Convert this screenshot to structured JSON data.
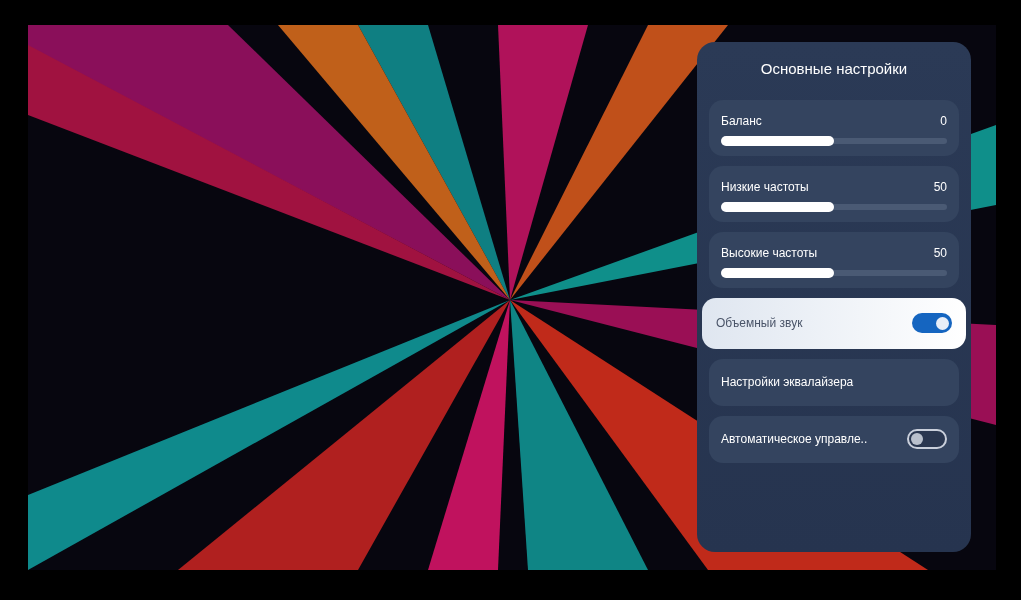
{
  "panel": {
    "title": "Основные настройки",
    "items": [
      {
        "kind": "slider",
        "label": "Баланс",
        "reading": "0",
        "level": 0.5,
        "selected": false
      },
      {
        "kind": "slider",
        "label": "Низкие частоты",
        "reading": "50",
        "level": 0.5,
        "selected": false
      },
      {
        "kind": "slider",
        "label": "Высокие частоты",
        "reading": "50",
        "level": 0.5,
        "selected": false
      },
      {
        "kind": "toggle",
        "label": "Объемный звук",
        "on": true,
        "selected": true
      },
      {
        "kind": "link",
        "label": "Настройки эквалайзера",
        "selected": false
      },
      {
        "kind": "toggle",
        "label": "Автоматическое управле..",
        "on": false,
        "selected": false
      }
    ]
  }
}
